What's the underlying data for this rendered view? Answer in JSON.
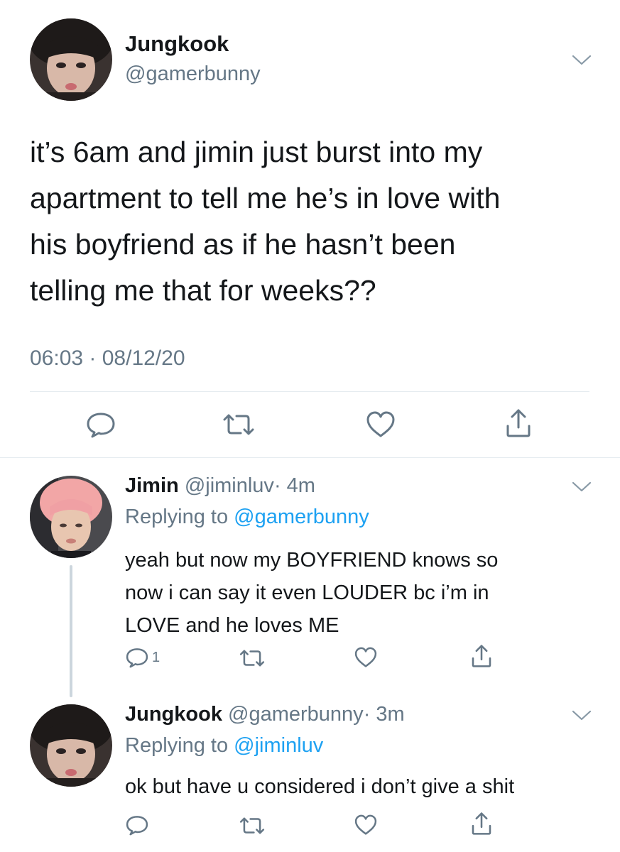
{
  "main_tweet": {
    "display_name": "Jungkook",
    "handle": "@gamerbunny",
    "text_lines": [
      "it’s 6am and jimin just burst into my",
      "apartment to tell me he’s in love with",
      "his boyfriend as if he hasn’t been",
      "telling me that for weeks??"
    ],
    "timestamp": "06:03 · 08/12/20"
  },
  "replies": [
    {
      "display_name": "Jimin",
      "handle": "@jiminluv",
      "time": "· 4m",
      "replying_prefix": "Replying to",
      "replying_to": "@gamerbunny",
      "text_lines": [
        "yeah but now my BOYFRIEND knows so",
        "now i can say it even LOUDER bc i’m in",
        "LOVE and he loves ME"
      ],
      "reply_count": "1"
    },
    {
      "display_name": "Jungkook",
      "handle": "@gamerbunny",
      "time": "· 3m",
      "replying_prefix": "Replying to",
      "replying_to": "@jiminluv",
      "text_lines": [
        "ok but have u considered i don’t give a shit"
      ]
    }
  ],
  "colors": {
    "text": "#14171a",
    "muted": "#657786",
    "link": "#1da1f2",
    "icon": "#657786",
    "divider": "#e6ecf0"
  },
  "icons": {
    "reply": "speech-bubble-icon",
    "retweet": "retweet-arrows-icon",
    "like": "heart-icon",
    "share": "share-upload-icon",
    "menu": "chevron-down-icon"
  }
}
